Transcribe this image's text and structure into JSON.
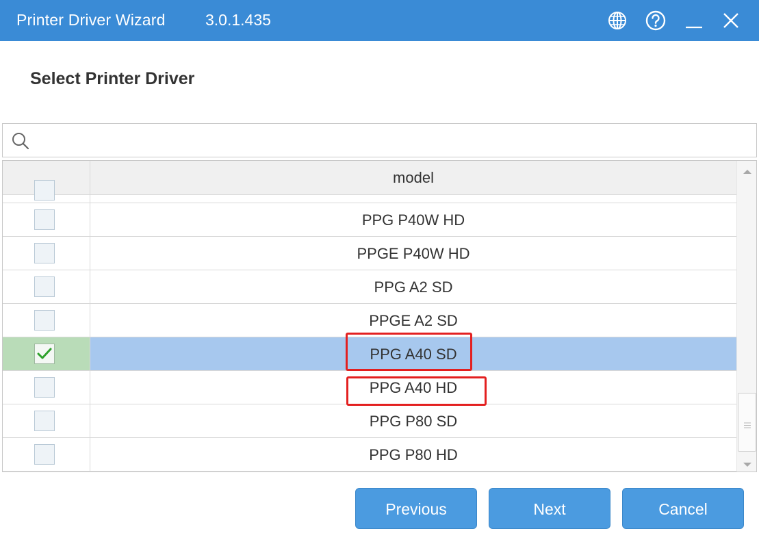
{
  "window": {
    "title": "Printer Driver Wizard",
    "version": "3.0.1.435",
    "accent_color": "#3a8bd6"
  },
  "titlebar_icons": [
    "globe-icon",
    "help-icon",
    "minimize-icon",
    "close-icon"
  ],
  "heading": "Select Printer Driver",
  "search": {
    "value": "",
    "placeholder": ""
  },
  "table": {
    "columns": [
      "",
      "model"
    ],
    "rows": [
      {
        "model": "PPG P40W HD",
        "checked": false
      },
      {
        "model": "PPGE P40W HD",
        "checked": false
      },
      {
        "model": "PPG A2 SD",
        "checked": false
      },
      {
        "model": "PPGE A2 SD",
        "checked": false
      },
      {
        "model": "PPG A40 SD",
        "checked": true
      },
      {
        "model": "PPG A40 HD",
        "checked": false
      },
      {
        "model": "PPG P80 SD",
        "checked": false
      },
      {
        "model": "PPG P80 HD",
        "checked": false
      }
    ],
    "selected_row_color": "#a7c8ee",
    "highlighted_models": [
      "PPG A40 SD",
      "PPG A40 HD"
    ],
    "highlight_color": "#e32020"
  },
  "buttons": {
    "previous": "Previous",
    "next": "Next",
    "cancel": "Cancel"
  }
}
